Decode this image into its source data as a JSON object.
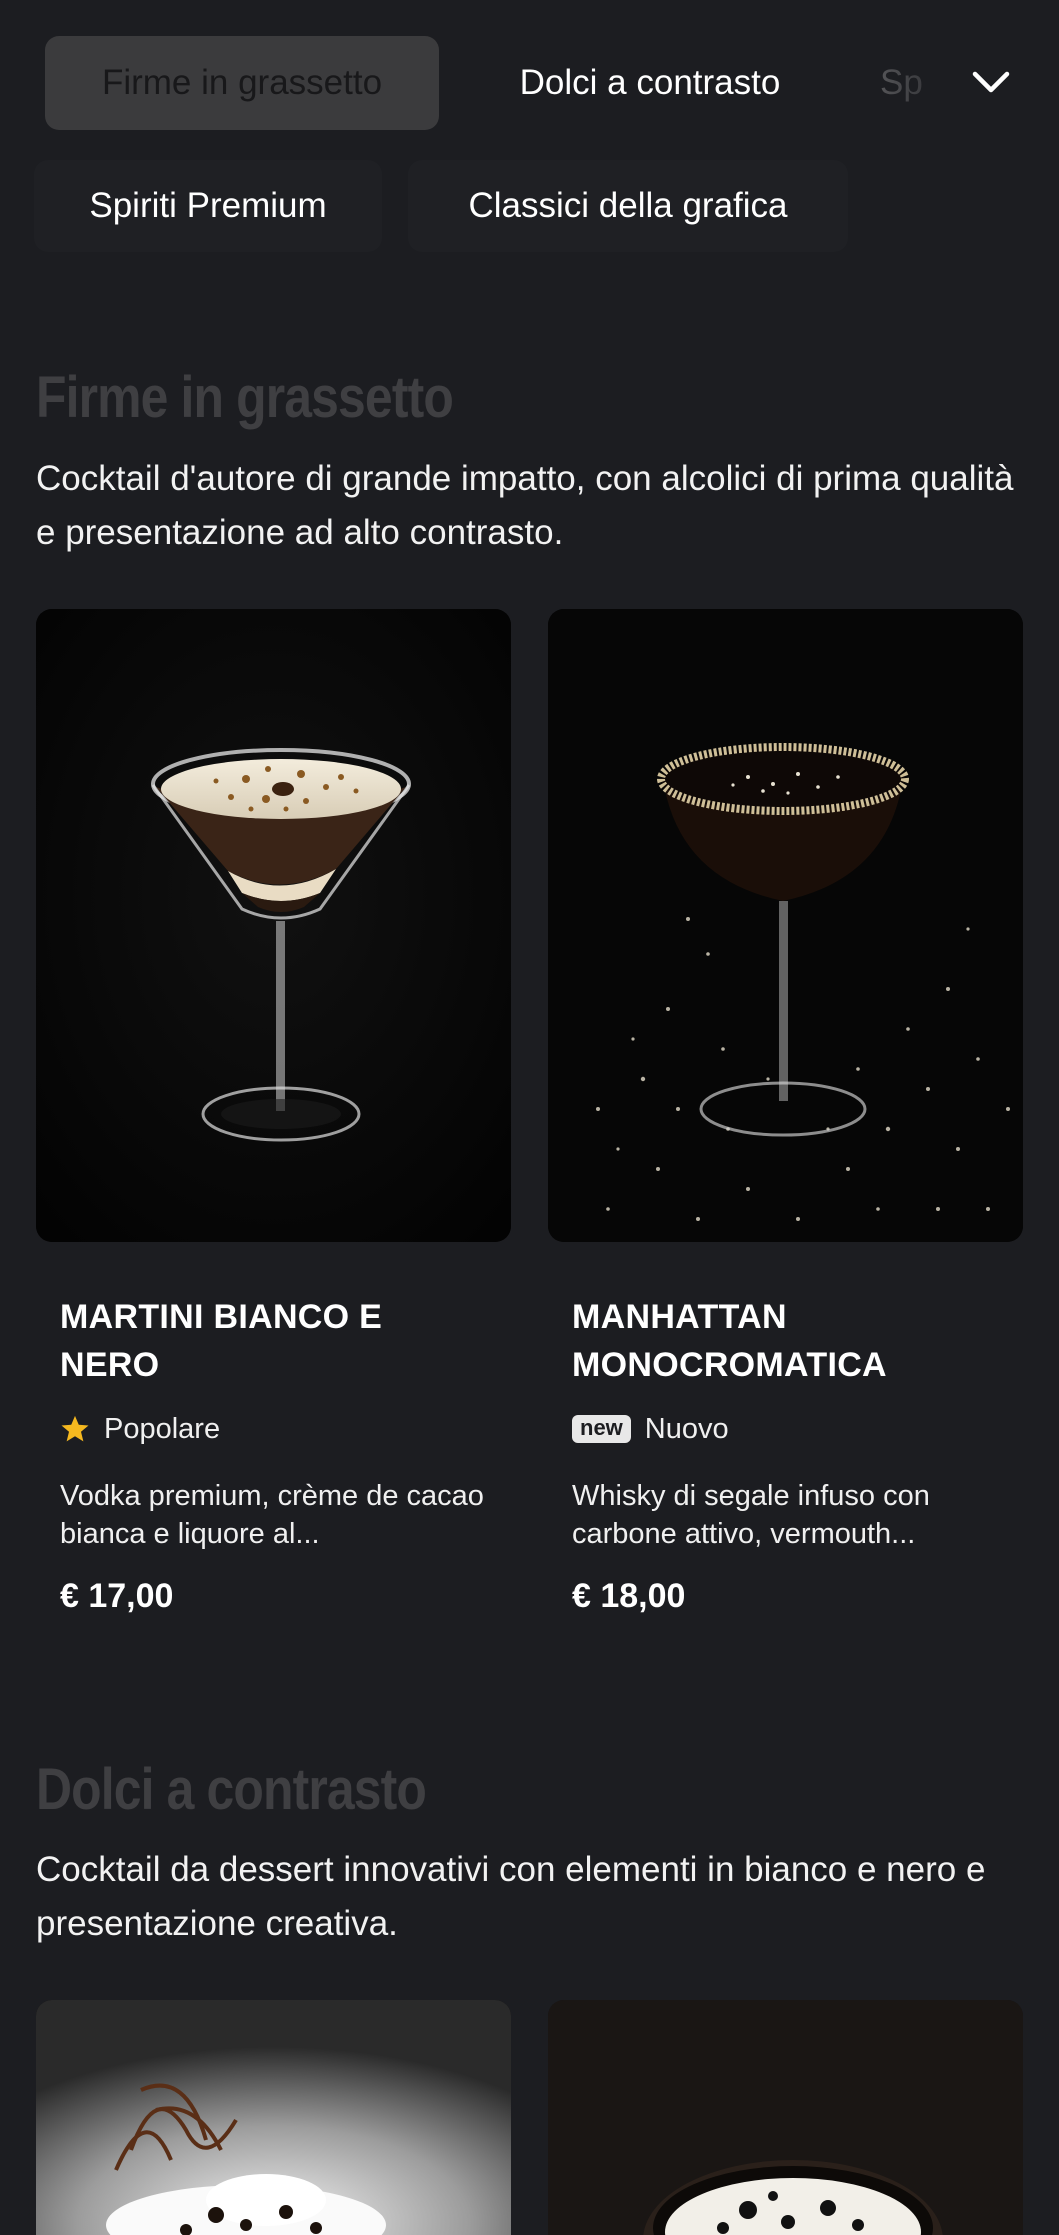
{
  "nav": {
    "categories": [
      "Firme in grassetto",
      "Dolci a contrasto",
      "Spiriti Premium",
      "Classici della grafica"
    ],
    "partial_label": "Sp",
    "expand_icon": "chevron-down-icon"
  },
  "sections": [
    {
      "title": "Firme in grassetto",
      "description": "Cocktail d'autore di grande impatto, con alcolici di prima qualità e presentazione ad alto contrasto.",
      "items": [
        {
          "name": "MARTINI BIANCO E NERO",
          "badge_icon": "star-icon",
          "badge": "Popolare",
          "description": "Vodka premium, crème de cacao bianca e liquore al...",
          "price": "€ 17,00"
        },
        {
          "name": "MANHATTAN MONOCROMATICA",
          "badge_icon": "new-tag",
          "badge_tag": "new",
          "badge": "Nuovo",
          "description": "Whisky di segale infuso con carbone attivo, vermouth...",
          "price": "€ 18,00"
        }
      ]
    },
    {
      "title": "Dolci a contrasto",
      "description": "Cocktail da dessert innovativi con elementi in bianco e nero e presentazione creativa."
    }
  ],
  "colors": {
    "background": "#1c1d21",
    "active_pill": "#3b3b3d",
    "section_title": "#3f3f42",
    "star": "#f5b81f"
  }
}
